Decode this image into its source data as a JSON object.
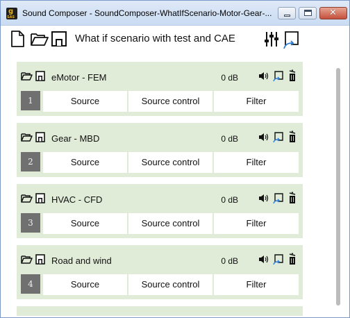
{
  "window": {
    "title": "Sound Composer - SoundComposer-WhatIfScenario-Motor-Gear-...",
    "app_icon_glyph": "g",
    "app_icon_caption": "SAS"
  },
  "toolbar": {
    "scenario_title": "What if scenario with test and CAE",
    "icons": [
      "new-file-icon",
      "open-folder-icon",
      "save-icon",
      "settings-sliders-icon",
      "export-icon"
    ]
  },
  "channels": [
    {
      "number": "1",
      "name": "eMotor - FEM",
      "level": "0 dB",
      "source_label": "Source",
      "source_control_label": "Source control",
      "filter_label": "Filter"
    },
    {
      "number": "2",
      "name": "Gear - MBD",
      "level": "0 dB",
      "source_label": "Source",
      "source_control_label": "Source control",
      "filter_label": "Filter"
    },
    {
      "number": "3",
      "name": "HVAC - CFD",
      "level": "0 dB",
      "source_label": "Source",
      "source_control_label": "Source control",
      "filter_label": "Filter"
    },
    {
      "number": "4",
      "name": "Road and wind",
      "level": "0 dB",
      "source_label": "Source",
      "source_control_label": "Source control",
      "filter_label": "Filter"
    }
  ],
  "colors": {
    "channel_bg": "#e1ecd8",
    "number_badge": "#707070",
    "accent_blue": "#2b7bd3"
  }
}
